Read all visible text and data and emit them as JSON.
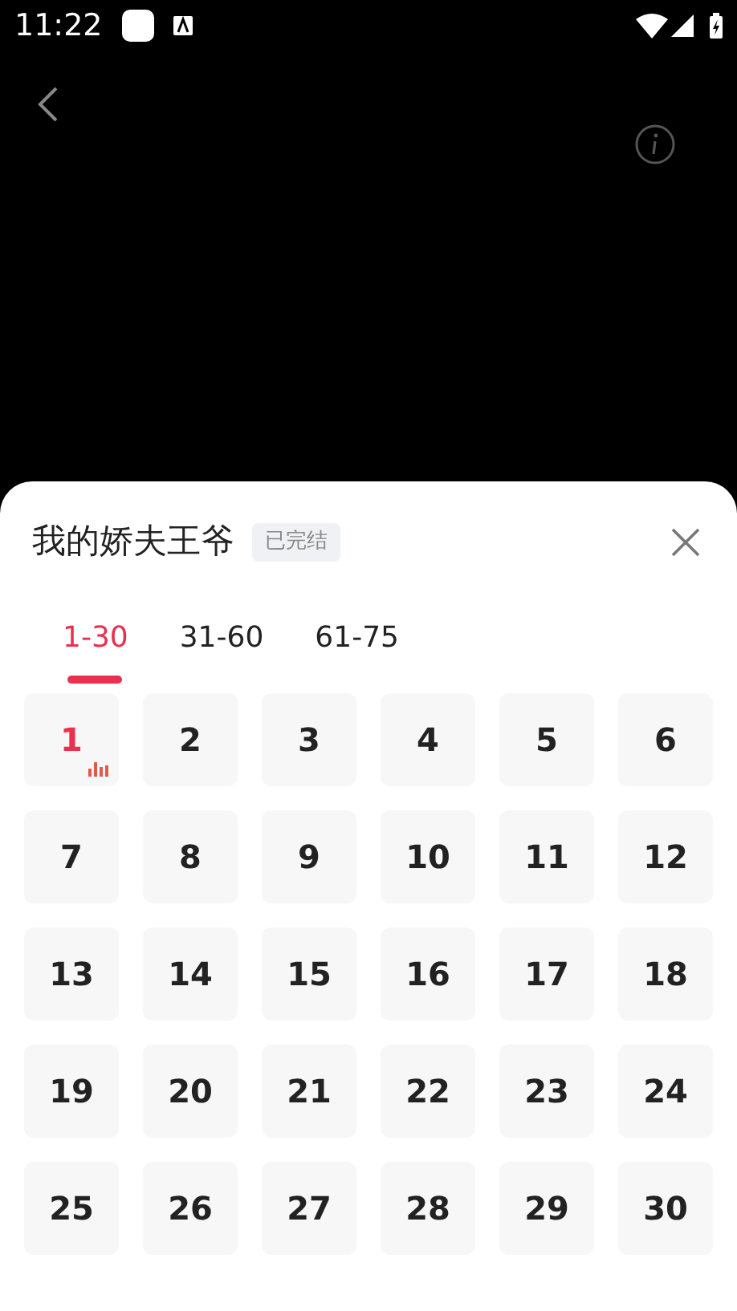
{
  "status_bar": {
    "time": "11:22"
  },
  "sheet": {
    "title": "我的娇夫王爷",
    "badge": "已完结"
  },
  "tabs": [
    {
      "label": "1-30",
      "selected": true
    },
    {
      "label": "31-60",
      "selected": false
    },
    {
      "label": "61-75",
      "selected": false
    }
  ],
  "episodes": [
    {
      "label": "1",
      "playing": true
    },
    {
      "label": "2",
      "playing": false
    },
    {
      "label": "3",
      "playing": false
    },
    {
      "label": "4",
      "playing": false
    },
    {
      "label": "5",
      "playing": false
    },
    {
      "label": "6",
      "playing": false
    },
    {
      "label": "7",
      "playing": false
    },
    {
      "label": "8",
      "playing": false
    },
    {
      "label": "9",
      "playing": false
    },
    {
      "label": "10",
      "playing": false
    },
    {
      "label": "11",
      "playing": false
    },
    {
      "label": "12",
      "playing": false
    },
    {
      "label": "13",
      "playing": false
    },
    {
      "label": "14",
      "playing": false
    },
    {
      "label": "15",
      "playing": false
    },
    {
      "label": "16",
      "playing": false
    },
    {
      "label": "17",
      "playing": false
    },
    {
      "label": "18",
      "playing": false
    },
    {
      "label": "19",
      "playing": false
    },
    {
      "label": "20",
      "playing": false
    },
    {
      "label": "21",
      "playing": false
    },
    {
      "label": "22",
      "playing": false
    },
    {
      "label": "23",
      "playing": false
    },
    {
      "label": "24",
      "playing": false
    },
    {
      "label": "25",
      "playing": false
    },
    {
      "label": "26",
      "playing": false
    },
    {
      "label": "27",
      "playing": false
    },
    {
      "label": "28",
      "playing": false
    },
    {
      "label": "29",
      "playing": false
    },
    {
      "label": "30",
      "playing": false
    }
  ]
}
